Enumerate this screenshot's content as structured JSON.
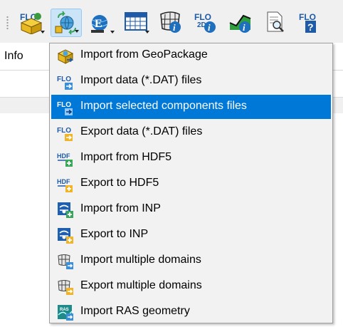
{
  "toolbar": {
    "buttons": [
      {
        "icon": "flo2d-import-box-icon",
        "has_dropdown": true
      },
      {
        "icon": "import-export-globe-icon",
        "has_dropdown": true,
        "pressed": true
      },
      {
        "icon": "globe-e-icon",
        "has_dropdown": true
      },
      {
        "icon": "grid-table-icon",
        "has_dropdown": true
      },
      {
        "icon": "grid-info-icon",
        "has_dropdown": false
      },
      {
        "icon": "flo2d-info-icon",
        "has_dropdown": false
      },
      {
        "icon": "profile-info-icon",
        "has_dropdown": false
      },
      {
        "icon": "document-search-icon",
        "has_dropdown": false
      },
      {
        "icon": "flo2d-help-icon",
        "has_dropdown": false
      }
    ]
  },
  "pane": {
    "tab_label": "Info"
  },
  "menu": {
    "items": [
      {
        "label": "Import from GeoPackage",
        "icon": "geopackage-import-icon",
        "selected": false
      },
      {
        "label": "Import data (*.DAT) files",
        "icon": "flo-import-icon",
        "selected": false
      },
      {
        "label": "Import selected components files",
        "icon": "flo-import-icon",
        "selected": true
      },
      {
        "label": "Export data (*.DAT) files",
        "icon": "flo-export-icon",
        "selected": false
      },
      {
        "label": "Import from HDF5",
        "icon": "hdf5-import-icon",
        "selected": false
      },
      {
        "label": "Export to HDF5",
        "icon": "hdf5-export-icon",
        "selected": false
      },
      {
        "label": "Import from INP",
        "icon": "inp-import-icon",
        "selected": false
      },
      {
        "label": "Export to INP",
        "icon": "inp-export-icon",
        "selected": false
      },
      {
        "label": "Import multiple domains",
        "icon": "domains-import-icon",
        "selected": false
      },
      {
        "label": "Export multiple domains",
        "icon": "domains-export-icon",
        "selected": false
      },
      {
        "label": "Import RAS geometry",
        "icon": "ras-import-icon",
        "selected": false
      }
    ]
  },
  "colors": {
    "selection": "#0078d7",
    "pressed_button": "#cce4f7",
    "menu_background": "#f2f2f2"
  }
}
